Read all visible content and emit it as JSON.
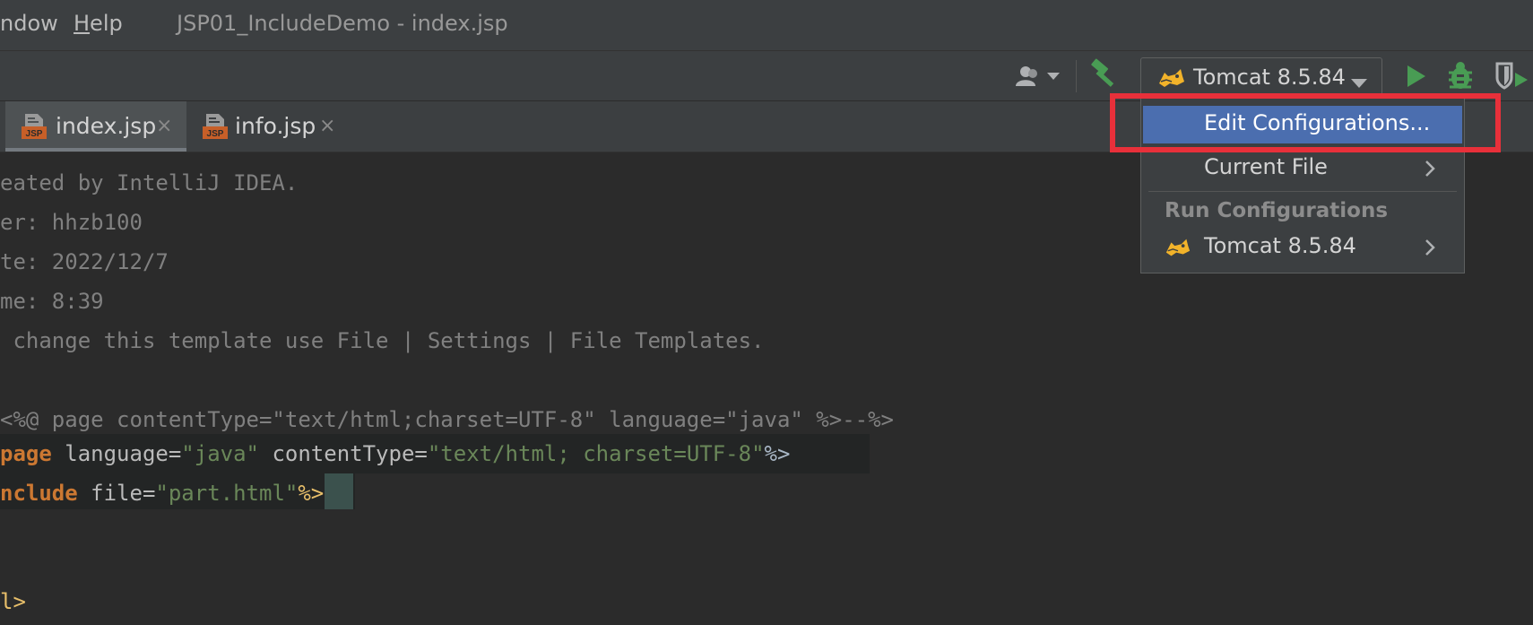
{
  "menu": {
    "window_partial": "ndow",
    "help": "Help",
    "help_mnemonic": "H",
    "help_rest": "elp"
  },
  "window_title": "JSP01_IncludeDemo - index.jsp",
  "toolbar": {
    "run_config_label": "Tomcat 8.5.84",
    "icons": [
      "user-icon",
      "build-hammer-icon",
      "tomcat-icon",
      "run-icon",
      "debug-icon",
      "run-coverage-icon"
    ],
    "colors": {
      "run": "#499c54",
      "build": "#499c54"
    }
  },
  "tabs": [
    {
      "name": "index.jsp",
      "active": true,
      "close": "×"
    },
    {
      "name": "info.jsp",
      "active": false,
      "close": "×"
    }
  ],
  "editor": {
    "lines": [
      {
        "segments": [
          {
            "t": "eated by IntelliJ IDEA.",
            "c": "comment"
          }
        ]
      },
      {
        "segments": [
          {
            "t": "er: hhzb100",
            "c": "comment"
          }
        ]
      },
      {
        "segments": [
          {
            "t": "te: 2022/12/7",
            "c": "comment"
          }
        ]
      },
      {
        "segments": [
          {
            "t": "me: 8:39",
            "c": "comment"
          }
        ]
      },
      {
        "segments": [
          {
            "t": " change this template use File | Settings | File Templates.",
            "c": "comment"
          }
        ]
      },
      {
        "segments": [
          {
            "t": "",
            "c": "plain"
          }
        ]
      },
      {
        "segments": [
          {
            "t": "<%@ page contentType=\"text/html;charset=UTF-8\" language=\"java\" %>--%>",
            "c": "comment"
          }
        ]
      },
      {
        "segments": [
          {
            "t": "page",
            "c": "kw"
          },
          {
            "t": " language=",
            "c": "attr"
          },
          {
            "t": "\"java\"",
            "c": "str"
          },
          {
            "t": " contentType=",
            "c": "attr"
          },
          {
            "t": "\"text/html; charset=UTF-8\"",
            "c": "str"
          },
          {
            "t": "%>",
            "c": "plain"
          }
        ]
      },
      {
        "segments": [
          {
            "t": "nclude",
            "c": "kw"
          },
          {
            "t": " file=",
            "c": "attr"
          },
          {
            "t": "\"part.html\"",
            "c": "str"
          },
          {
            "t": "%>",
            "c": "punc"
          }
        ]
      },
      {
        "segments": [
          {
            "t": "",
            "c": "plain"
          }
        ]
      },
      {
        "segments": [
          {
            "t": "",
            "c": "plain"
          }
        ]
      },
      {
        "segments": [
          {
            "t": "l>",
            "c": "tag"
          }
        ]
      }
    ]
  },
  "popup": {
    "edit_configurations": "Edit Configurations...",
    "current_file": "Current File",
    "run_configurations_header": "Run Configurations",
    "tomcat_item": "Tomcat 8.5.84"
  },
  "highlight_color": "#e8303a"
}
